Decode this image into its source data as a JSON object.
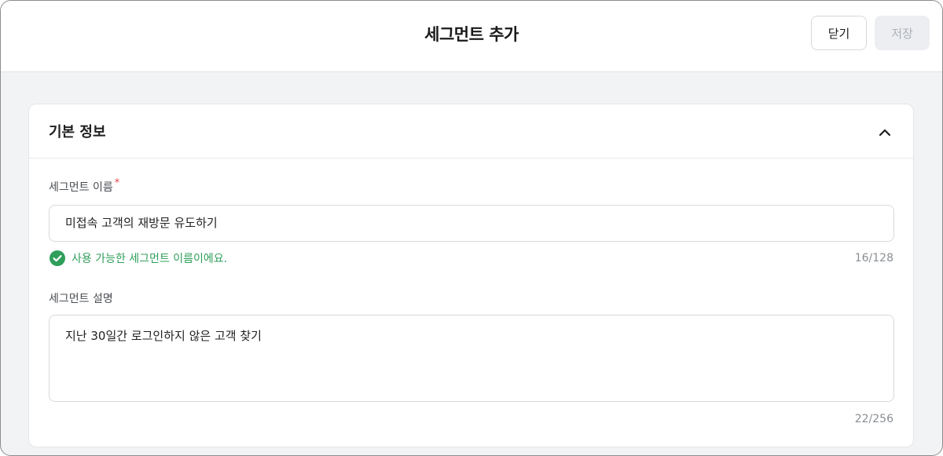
{
  "header": {
    "title": "세그먼트 추가",
    "close_label": "닫기",
    "save_label": "저장"
  },
  "section": {
    "title": "기본 정보",
    "collapse_icon": "chevron-up-icon"
  },
  "name_field": {
    "label": "세그먼트 이름",
    "required_mark": "*",
    "value": "미접속 고객의 재방문 유도하기",
    "validation_icon": "check-circle-icon",
    "validation_message": "사용 가능한 세그먼트 이름이에요.",
    "counter": "16/128"
  },
  "description_field": {
    "label": "세그먼트 설명",
    "value": "지난 30일간 로그인하지 않은 고객 찾기",
    "counter": "22/256"
  },
  "colors": {
    "success": "#2f9e5a",
    "required": "#e5484d",
    "disabled_bg": "#eceef1",
    "disabled_text": "#aeb2b8"
  }
}
